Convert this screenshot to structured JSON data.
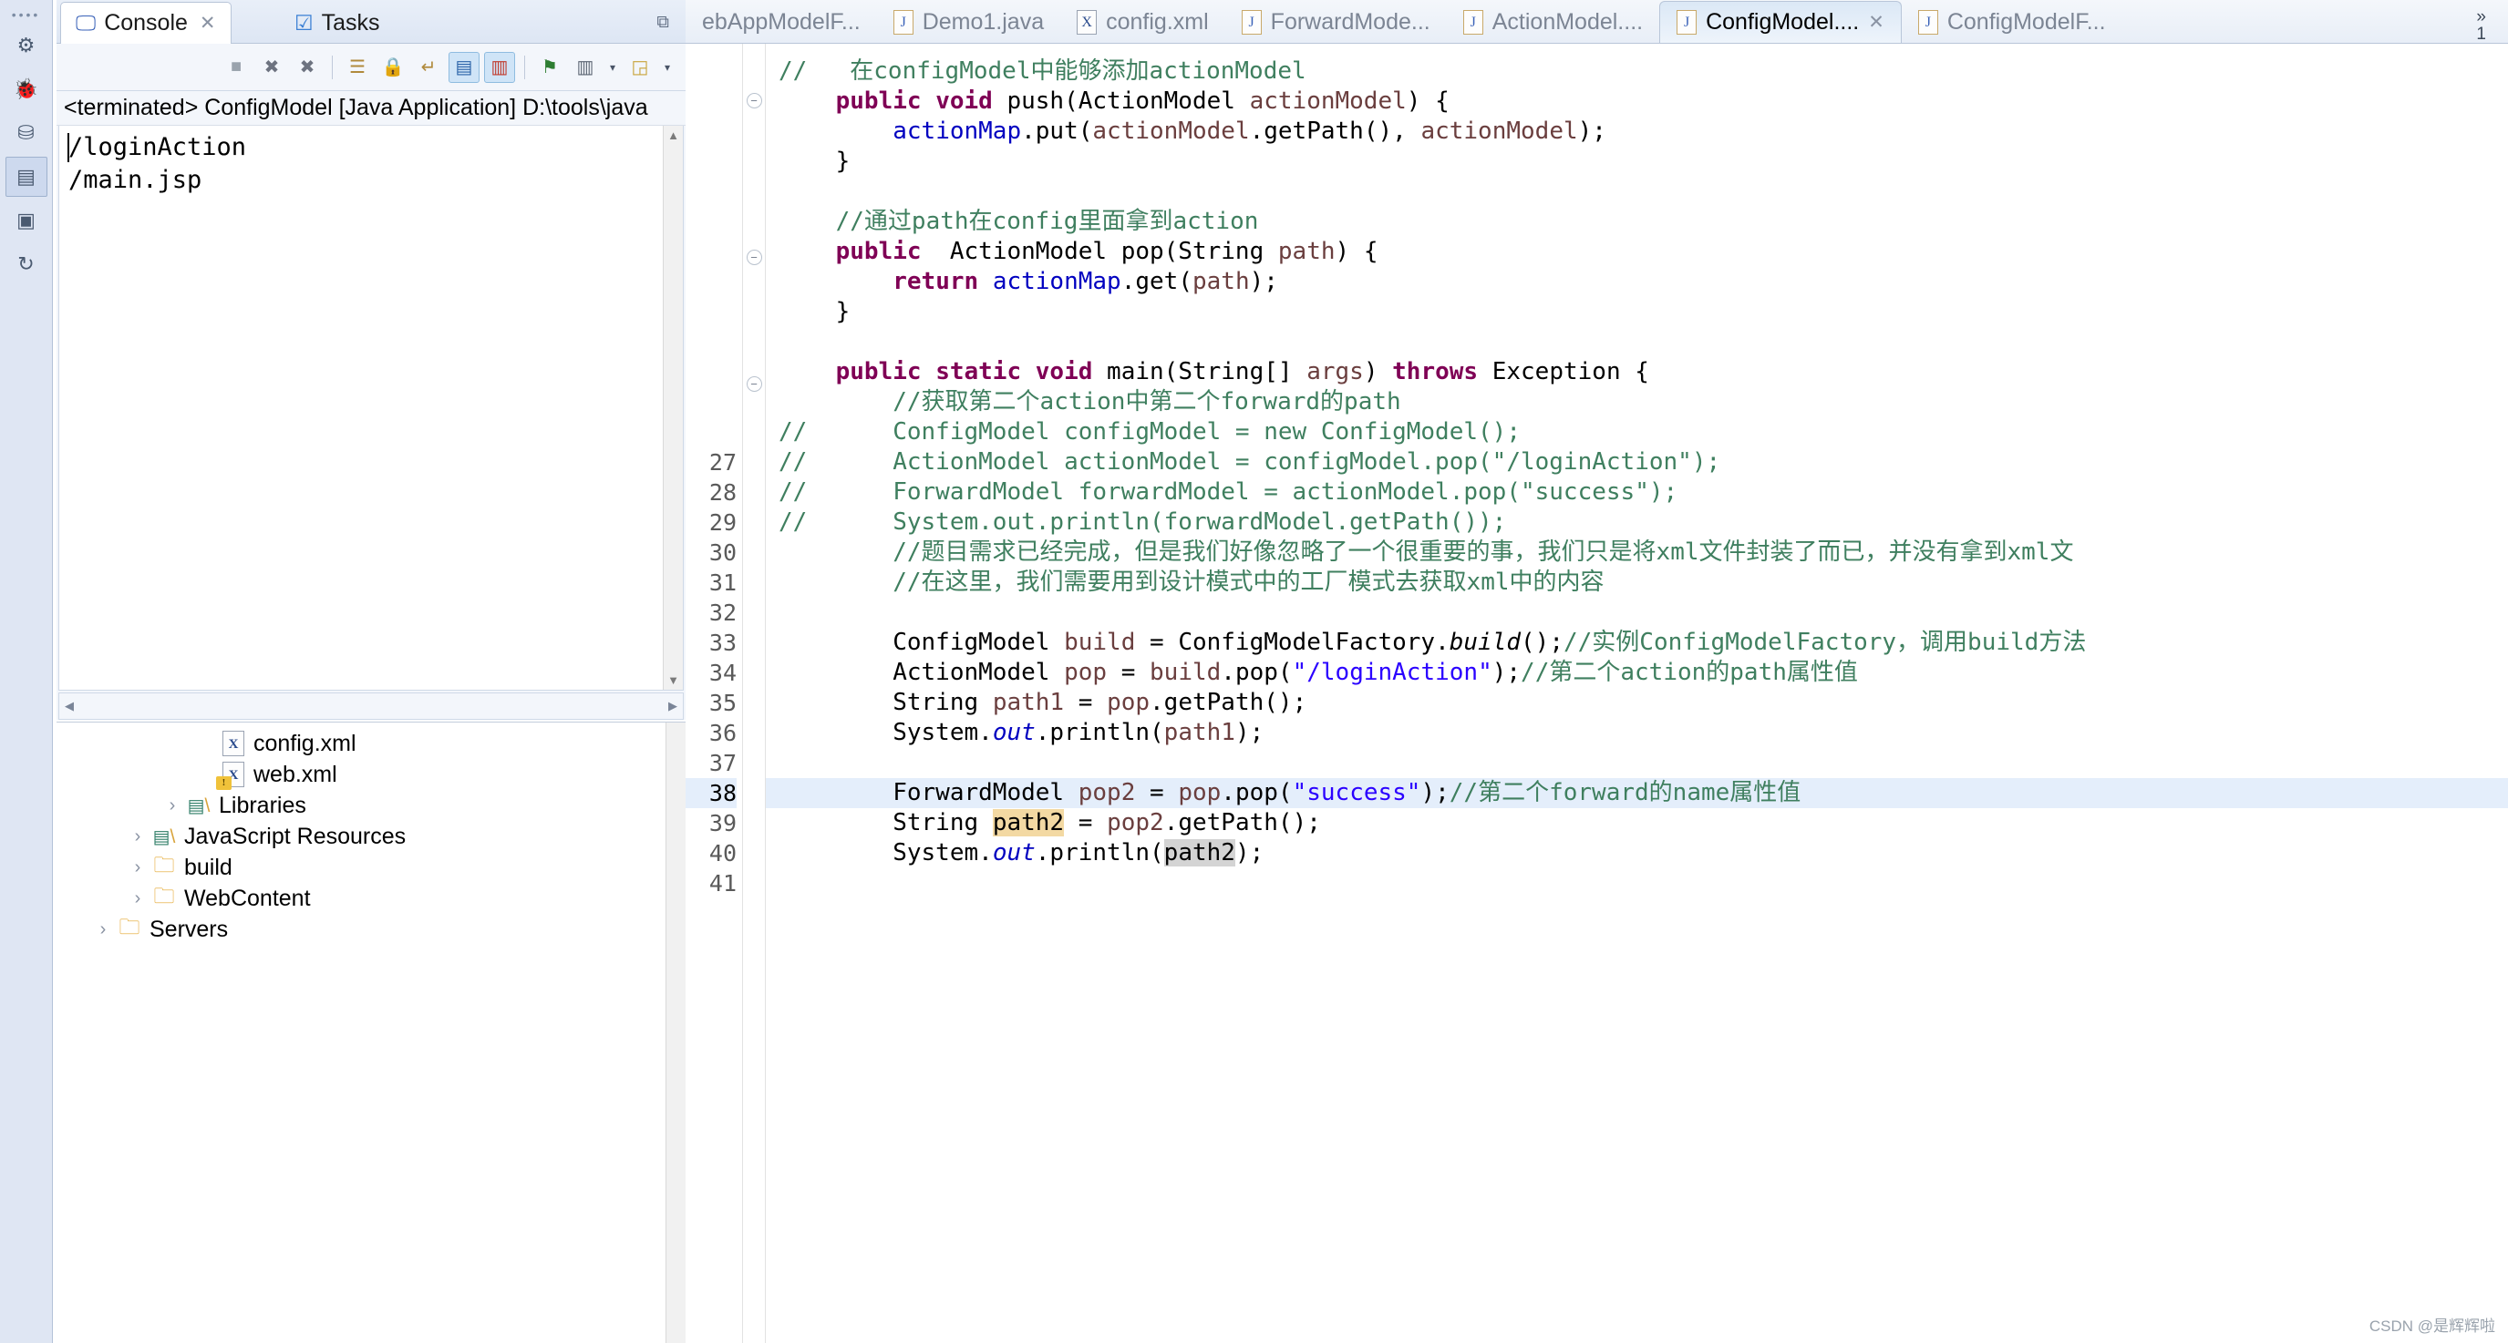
{
  "rail": {
    "items": [
      {
        "name": "perspective-dots",
        "glyph": "••••"
      },
      {
        "name": "java-perspective-icon",
        "glyph": "⚘"
      },
      {
        "name": "debug-perspective-icon",
        "glyph": "⚒"
      },
      {
        "name": "package-explorer-icon",
        "glyph": "☰"
      },
      {
        "name": "outline-icon",
        "glyph": "▤"
      },
      {
        "name": "servers-icon",
        "glyph": "▣"
      },
      {
        "name": "sync-icon",
        "glyph": "↻"
      }
    ]
  },
  "console": {
    "tabs": [
      {
        "label": "Console",
        "icon": "console-icon",
        "active": true,
        "closeable": true
      },
      {
        "label": "Tasks",
        "icon": "tasks-icon",
        "active": false,
        "closeable": false
      }
    ],
    "minimize_glyph": "❐",
    "toolbar": [
      {
        "name": "terminate-button",
        "glyph": "■",
        "active": false
      },
      {
        "name": "remove-launch-button",
        "glyph": "✖",
        "active": false
      },
      {
        "name": "remove-all-launches-button",
        "glyph": "✖",
        "active": false
      },
      {
        "name": "clear-console-button",
        "glyph": "☷",
        "active": false
      },
      {
        "name": "scroll-lock-button",
        "glyph": "ὑ2",
        "active": false
      },
      {
        "name": "word-wrap-button",
        "glyph": "↵",
        "active": false
      },
      {
        "name": "show-console-on-output-button",
        "glyph": "≡",
        "active": true
      },
      {
        "name": "show-console-on-error-button",
        "glyph": "✗",
        "active": true
      },
      {
        "name": "pin-console-button",
        "glyph": "⚑",
        "active": false
      },
      {
        "name": "display-selected-console-button",
        "glyph": "⎕",
        "active": false
      },
      {
        "name": "open-console-button",
        "glyph": "◱",
        "active": false
      }
    ],
    "header": "<terminated> ConfigModel [Java Application] D:\\tools\\java",
    "output": [
      "/loginAction",
      "/main.jsp"
    ]
  },
  "explorer": {
    "items": [
      {
        "label": "config.xml",
        "indent": 4,
        "twisty": "",
        "icon": "xml-file-icon",
        "warn": false
      },
      {
        "label": "web.xml",
        "indent": 4,
        "twisty": "",
        "icon": "xml-file-icon",
        "warn": true
      },
      {
        "label": "Libraries",
        "indent": 3,
        "twisty": "›",
        "icon": "library-icon",
        "warn": false
      },
      {
        "label": "JavaScript Resources",
        "indent": 2,
        "twisty": "›",
        "icon": "library-icon",
        "warn": false
      },
      {
        "label": "build",
        "indent": 2,
        "twisty": "›",
        "icon": "folder-icon",
        "warn": false
      },
      {
        "label": "WebContent",
        "indent": 2,
        "twisty": "›",
        "icon": "folder-icon",
        "warn": false
      },
      {
        "label": "Servers",
        "indent": 1,
        "twisty": "›",
        "icon": "folder-icon",
        "warn": false
      }
    ]
  },
  "editor": {
    "tabs": [
      {
        "label": "ebAppModelF...",
        "icon": "java-file-icon",
        "active": false,
        "closeable": false,
        "truncated_left": true
      },
      {
        "label": "Demo1.java",
        "icon": "java-file-icon",
        "active": false,
        "closeable": false
      },
      {
        "label": "config.xml",
        "icon": "xml-file-icon",
        "active": false,
        "closeable": false
      },
      {
        "label": "ForwardMode...",
        "icon": "java-file-icon",
        "active": false,
        "closeable": false
      },
      {
        "label": "ActionModel....",
        "icon": "java-file-icon",
        "active": false,
        "closeable": false
      },
      {
        "label": "ConfigModel....",
        "icon": "java-file-icon",
        "active": true,
        "closeable": true
      },
      {
        "label": "ConfigModelF...",
        "icon": "java-file-icon",
        "active": false,
        "closeable": false
      }
    ],
    "overflow_chevron": "»",
    "overflow_count": "1",
    "visible_line_numbers": [
      "27",
      "28",
      "29",
      "30",
      "31",
      "32",
      "33",
      "34",
      "35",
      "36",
      "37",
      "38",
      "39",
      "40",
      "41"
    ],
    "first_numbered_line_index": 13,
    "current_line": "38",
    "code_lines": [
      {
        "tokens": [
          {
            "t": "// ",
            "c": "cm"
          },
          {
            "t": "  ",
            "c": "plain"
          },
          {
            "t": "在configModel中能够添加actionModel",
            "c": "cm"
          }
        ],
        "fold": false
      },
      {
        "tokens": [
          {
            "t": "    ",
            "c": "plain"
          },
          {
            "t": "public void ",
            "c": "kw"
          },
          {
            "t": "push(ActionModel ",
            "c": "plain"
          },
          {
            "t": "actionModel",
            "c": "par"
          },
          {
            "t": ") {",
            "c": "plain"
          }
        ],
        "fold": true
      },
      {
        "tokens": [
          {
            "t": "        ",
            "c": "plain"
          },
          {
            "t": "actionMap",
            "c": "fld"
          },
          {
            "t": ".put(",
            "c": "plain"
          },
          {
            "t": "actionModel",
            "c": "par"
          },
          {
            "t": ".getPath(), ",
            "c": "plain"
          },
          {
            "t": "actionModel",
            "c": "par"
          },
          {
            "t": ");",
            "c": "plain"
          }
        ],
        "fold": false
      },
      {
        "tokens": [
          {
            "t": "    }",
            "c": "plain"
          }
        ],
        "fold": false
      },
      {
        "tokens": [],
        "fold": false
      },
      {
        "tokens": [
          {
            "t": "    ",
            "c": "plain"
          },
          {
            "t": "//通过path在config里面拿到action",
            "c": "cm"
          }
        ],
        "fold": false
      },
      {
        "tokens": [
          {
            "t": "    ",
            "c": "plain"
          },
          {
            "t": "public ",
            "c": "kw"
          },
          {
            "t": " ActionModel pop(String ",
            "c": "plain"
          },
          {
            "t": "path",
            "c": "par"
          },
          {
            "t": ") {",
            "c": "plain"
          }
        ],
        "fold": true
      },
      {
        "tokens": [
          {
            "t": "        ",
            "c": "plain"
          },
          {
            "t": "return ",
            "c": "kw"
          },
          {
            "t": "actionMap",
            "c": "fld"
          },
          {
            "t": ".get(",
            "c": "plain"
          },
          {
            "t": "path",
            "c": "par"
          },
          {
            "t": ");",
            "c": "plain"
          }
        ],
        "fold": false
      },
      {
        "tokens": [
          {
            "t": "    }",
            "c": "plain"
          }
        ],
        "fold": false
      },
      {
        "tokens": [],
        "fold": false
      },
      {
        "tokens": [
          {
            "t": "    ",
            "c": "plain"
          },
          {
            "t": "public static void ",
            "c": "kw"
          },
          {
            "t": "main(String[] ",
            "c": "plain"
          },
          {
            "t": "args",
            "c": "par"
          },
          {
            "t": ") ",
            "c": "plain"
          },
          {
            "t": "throws ",
            "c": "kw"
          },
          {
            "t": "Exception {",
            "c": "plain"
          }
        ],
        "fold": true
      },
      {
        "tokens": [
          {
            "t": "        ",
            "c": "plain"
          },
          {
            "t": "//获取第二个action中第二个forward的path",
            "c": "cm"
          }
        ],
        "fold": false
      },
      {
        "tokens": [
          {
            "t": "//      ConfigModel configModel = new ConfigModel();",
            "c": "cm"
          }
        ],
        "fold": false
      },
      {
        "tokens": [
          {
            "t": "//      ActionModel actionModel = configModel.pop(\"/loginAction\");",
            "c": "cm"
          }
        ],
        "fold": false
      },
      {
        "tokens": [
          {
            "t": "//      ForwardModel forwardModel = actionModel.pop(\"success\");",
            "c": "cm"
          }
        ],
        "fold": false
      },
      {
        "tokens": [
          {
            "t": "//      System.out.println(forwardModel.getPath());",
            "c": "cm"
          }
        ],
        "fold": false
      },
      {
        "tokens": [
          {
            "t": "        ",
            "c": "plain"
          },
          {
            "t": "//题目需求已经完成，但是我们好像忽略了一个很重要的事，我们只是将xml文件封装了而已，并没有拿到xml文",
            "c": "cm"
          }
        ],
        "fold": false
      },
      {
        "tokens": [
          {
            "t": "        ",
            "c": "plain"
          },
          {
            "t": "//在这里，我们需要用到设计模式中的工厂模式去获取xml中的内容",
            "c": "cm"
          }
        ],
        "fold": false
      },
      {
        "tokens": [],
        "fold": false
      },
      {
        "tokens": [
          {
            "t": "        ConfigModel ",
            "c": "plain"
          },
          {
            "t": "build",
            "c": "loc"
          },
          {
            "t": " = ConfigModelFactory.",
            "c": "plain"
          },
          {
            "t": "build",
            "c": "smth"
          },
          {
            "t": "();",
            "c": "plain"
          },
          {
            "t": "//实例ConfigModelFactory，调用build方法",
            "c": "cm"
          }
        ],
        "fold": false
      },
      {
        "tokens": [
          {
            "t": "        ActionModel ",
            "c": "plain"
          },
          {
            "t": "pop",
            "c": "loc"
          },
          {
            "t": " = ",
            "c": "plain"
          },
          {
            "t": "build",
            "c": "loc"
          },
          {
            "t": ".pop(",
            "c": "plain"
          },
          {
            "t": "\"/loginAction\"",
            "c": "st"
          },
          {
            "t": ");",
            "c": "plain"
          },
          {
            "t": "//第二个action的path属性值",
            "c": "cm"
          }
        ],
        "fold": false
      },
      {
        "tokens": [
          {
            "t": "        String ",
            "c": "plain"
          },
          {
            "t": "path1",
            "c": "loc"
          },
          {
            "t": " = ",
            "c": "plain"
          },
          {
            "t": "pop",
            "c": "loc"
          },
          {
            "t": ".getPath();",
            "c": "plain"
          }
        ],
        "fold": false
      },
      {
        "tokens": [
          {
            "t": "        System.",
            "c": "plain"
          },
          {
            "t": "out",
            "c": "sfld"
          },
          {
            "t": ".println(",
            "c": "plain"
          },
          {
            "t": "path1",
            "c": "loc"
          },
          {
            "t": ");",
            "c": "plain"
          }
        ],
        "fold": false
      },
      {
        "tokens": [],
        "fold": false
      },
      {
        "tokens": [
          {
            "t": "        ForwardModel ",
            "c": "plain"
          },
          {
            "t": "pop2",
            "c": "loc"
          },
          {
            "t": " = ",
            "c": "plain"
          },
          {
            "t": "pop",
            "c": "loc"
          },
          {
            "t": ".pop(",
            "c": "plain"
          },
          {
            "t": "\"success\"",
            "c": "st"
          },
          {
            "t": ");",
            "c": "plain"
          },
          {
            "t": "//第二个forward的name属性值",
            "c": "cm"
          }
        ],
        "fold": false
      },
      {
        "tokens": [
          {
            "t": "        String ",
            "c": "plain"
          },
          {
            "t": "path2",
            "c": "occ"
          },
          {
            "t": " = ",
            "c": "plain"
          },
          {
            "t": "pop2",
            "c": "loc"
          },
          {
            "t": ".getPath();",
            "c": "plain"
          }
        ],
        "fold": false
      },
      {
        "tokens": [
          {
            "t": "        System.",
            "c": "plain"
          },
          {
            "t": "out",
            "c": "sfld"
          },
          {
            "t": ".println(",
            "c": "plain"
          },
          {
            "t": "path2",
            "c": "occ2"
          },
          {
            "t": ");",
            "c": "plain"
          }
        ],
        "fold": false
      },
      {
        "tokens": [],
        "fold": false
      },
      {
        "tokens": [],
        "fold": false
      },
      {
        "tokens": [],
        "fold": false
      }
    ]
  },
  "watermark": "CSDN @是辉辉啦",
  "colors": {
    "keyword": "#7f0055",
    "comment": "#3f7f5f",
    "string": "#2a00ff",
    "field": "#0000c0",
    "parameter": "#6a3e3e",
    "current_line_bg": "#e4eefb",
    "occurrence_bg": "#f3d9a3",
    "tab_active_bg": "#dbe8f6",
    "rail_bg": "#dfe6f3"
  }
}
